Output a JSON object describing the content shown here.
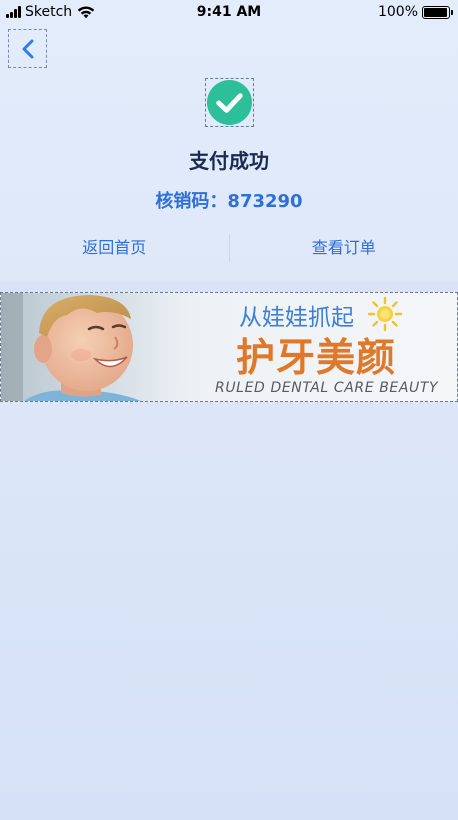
{
  "status_bar": {
    "carrier": "Sketch",
    "time": "9:41 AM",
    "battery_percent": "100%",
    "battery_level": 1.0
  },
  "header": {
    "back_icon": "chevron-left-icon"
  },
  "result": {
    "icon": "check-circle-icon",
    "icon_color": "#2dbf99",
    "title": "支付成功",
    "code_text": "核销码：873290"
  },
  "actions": {
    "home_label": "返回首页",
    "order_label": "查看订单"
  },
  "banner": {
    "headline_small": "从娃娃抓起",
    "headline_big": "护牙美颜",
    "subtitle_en": "RULED DENTAL CARE BEAUTY"
  },
  "colors": {
    "accent": "#2f6fd8",
    "success": "#2dbf99",
    "banner_orange": "#e0782a"
  }
}
